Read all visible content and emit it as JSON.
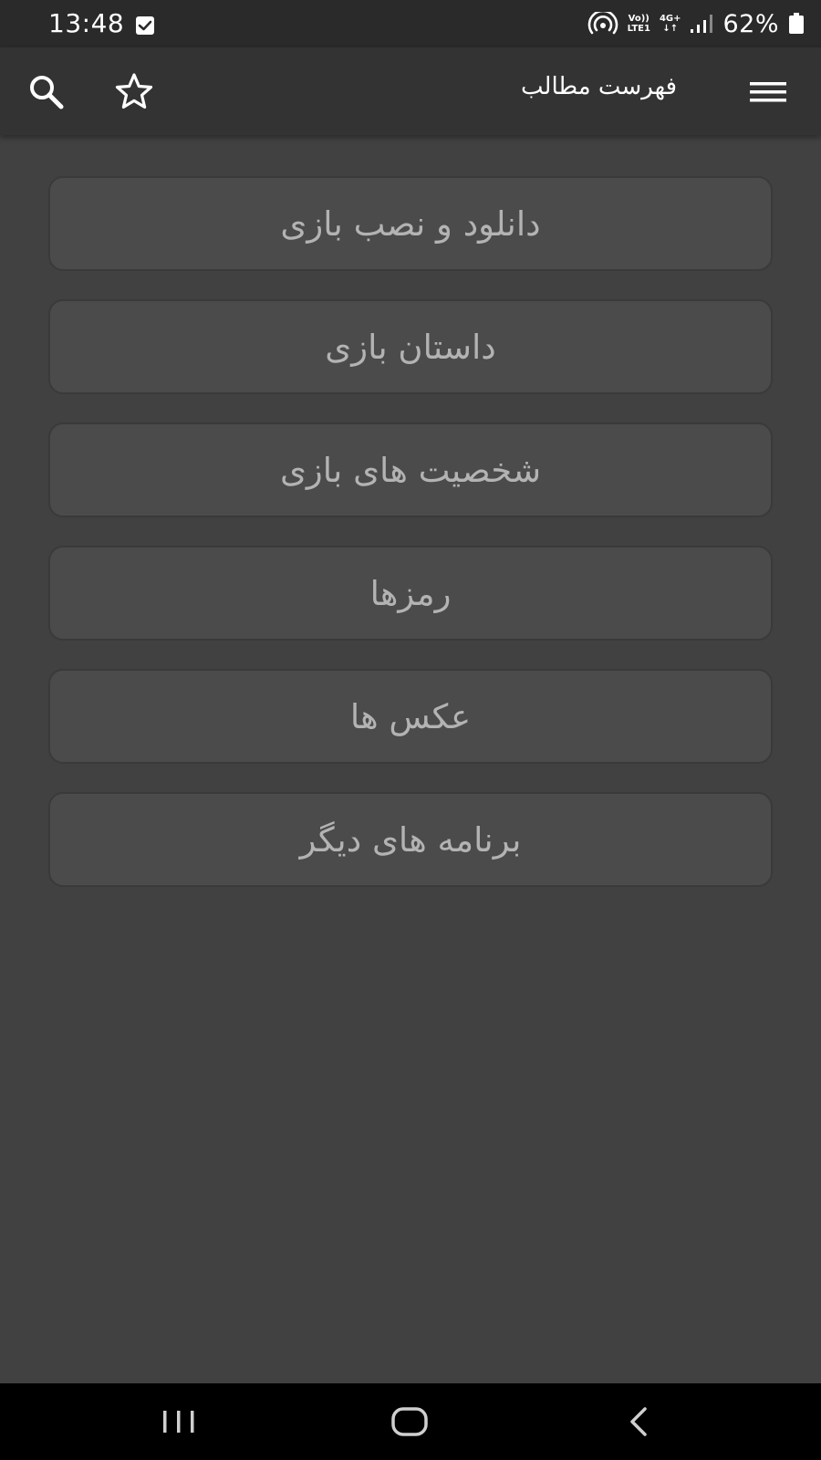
{
  "status_bar": {
    "time": "13:48",
    "volte_top": "Vo))",
    "volte_bottom": "LTE1",
    "network_top": "4G+",
    "network_bottom": "↓↑",
    "battery_percent": "62%"
  },
  "app_bar": {
    "title": "فهرست مطالب"
  },
  "menu": {
    "items": [
      {
        "label": "دانلود و نصب بازی"
      },
      {
        "label": "داستان بازی"
      },
      {
        "label": "شخصیت های بازی"
      },
      {
        "label": "رمزها"
      },
      {
        "label": "عکس ها"
      },
      {
        "label": "برنامه های دیگر"
      }
    ]
  },
  "colors": {
    "status_bar_bg": "#2a2a2a",
    "app_bar_bg": "#333333",
    "content_bg": "#414141",
    "button_bg": "#4b4b4b",
    "button_text": "#b3b3b3",
    "nav_bar_bg": "#000000"
  },
  "icons": {
    "search": "search-icon",
    "favorite": "star-outline-icon",
    "menu": "hamburger-menu-icon"
  }
}
